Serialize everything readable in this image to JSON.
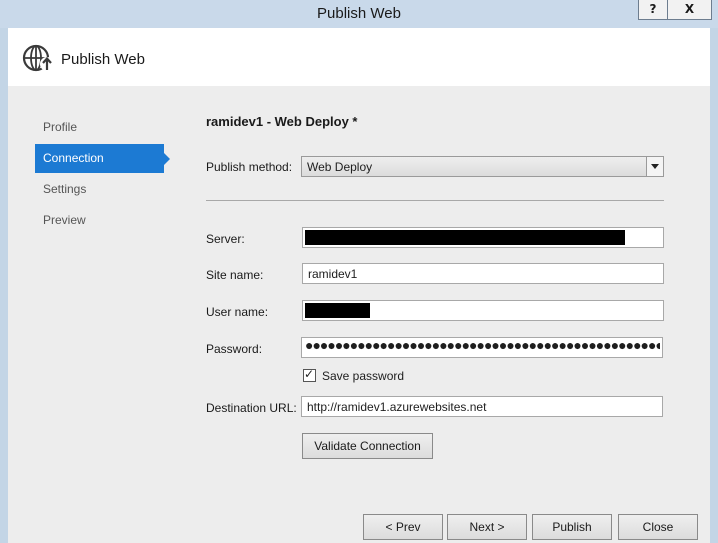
{
  "window": {
    "title": "Publish Web",
    "help_label": "?",
    "close_label": "X"
  },
  "header": {
    "title": "Publish Web",
    "icon": "globe-publish-icon"
  },
  "nav": {
    "items": [
      {
        "label": "Profile"
      },
      {
        "label": "Connection",
        "active": true
      },
      {
        "label": "Settings"
      },
      {
        "label": "Preview"
      }
    ]
  },
  "profile_title": "ramidev1 - Web Deploy *",
  "publish_method": {
    "label": "Publish method:",
    "value": "Web Deploy"
  },
  "server": {
    "label": "Server:",
    "value": ""
  },
  "site_name": {
    "label": "Site name:",
    "value": "ramidev1"
  },
  "user_name": {
    "label": "User name:",
    "value": ""
  },
  "password": {
    "label": "Password:",
    "value": "●●●●●●●●●●●●●●●●●●●●●●●●●●●●●●●●●●●●●●●●●●●●●●●●●●●●●●●●●●●●"
  },
  "save_password": {
    "label": "Save password",
    "checked": true
  },
  "destination_url": {
    "label": "Destination URL:",
    "value": "http://ramidev1.azurewebsites.net"
  },
  "validate_button": "Validate Connection",
  "footer": {
    "prev": "< Prev",
    "next": "Next >",
    "publish": "Publish",
    "close": "Close"
  },
  "colors": {
    "accent": "#1c7ad3",
    "titlebar": "#c9d9ea"
  }
}
